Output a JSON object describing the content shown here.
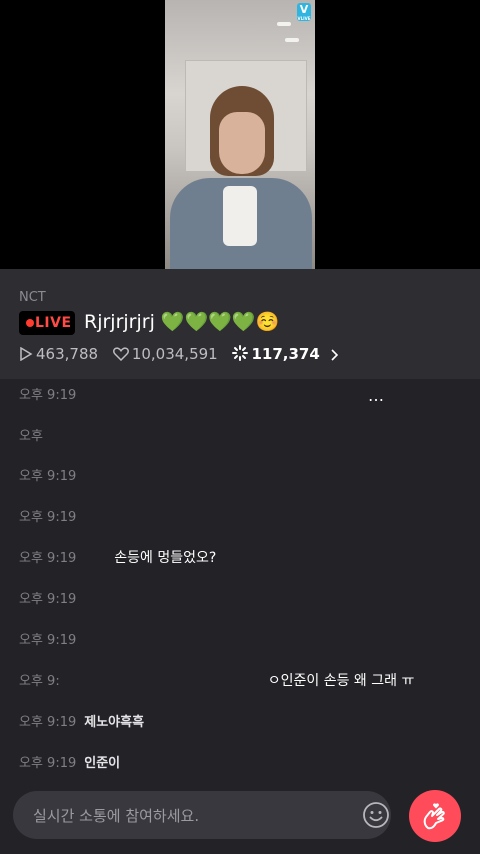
{
  "video": {
    "logo_text": "V",
    "logo_sub": "VLIVE"
  },
  "stream": {
    "channel": "NCT",
    "live_badge": "LIVE",
    "title": "Rjrjrjrjrj 💚💚💚💚☺️",
    "plays": "463,788",
    "likes": "10,034,591",
    "current_viewers": "117,374"
  },
  "chat": {
    "more_icon": "…",
    "messages": [
      {
        "time": "오후 9:19",
        "nick": "",
        "text": ""
      },
      {
        "time": "오후",
        "nick": "",
        "text": ""
      },
      {
        "time": "오후 9:19",
        "nick": "",
        "text": ""
      },
      {
        "time": "오후 9:19",
        "nick": "",
        "text": ""
      },
      {
        "time": "오후 9:19",
        "nick": "",
        "text": "손등에 멍들었오?"
      },
      {
        "time": "오후 9:19",
        "nick": "",
        "text": ""
      },
      {
        "time": "오후 9:19",
        "nick": "",
        "text": ""
      },
      {
        "time": "오후 9:",
        "nick": "",
        "text": "ㅇ인준이 손등 왜 그래 ㅠ"
      },
      {
        "time": "오후 9:19",
        "nick": "제노야흑흑",
        "text": ""
      },
      {
        "time": "오후 9:19",
        "nick": "인준이",
        "text": ""
      }
    ]
  },
  "input": {
    "placeholder": "실시간 소통에 참여하세요."
  },
  "icons": {
    "play": "play-icon",
    "heart": "heart-icon",
    "viewers": "viewers-icon",
    "chevron": "chevron-right-icon",
    "emoji": "emoji-icon",
    "finger_heart": "finger-heart-icon"
  },
  "colors": {
    "accent_red": "#ff4b5a",
    "live_red": "#ff4a45",
    "background": "#232327"
  }
}
